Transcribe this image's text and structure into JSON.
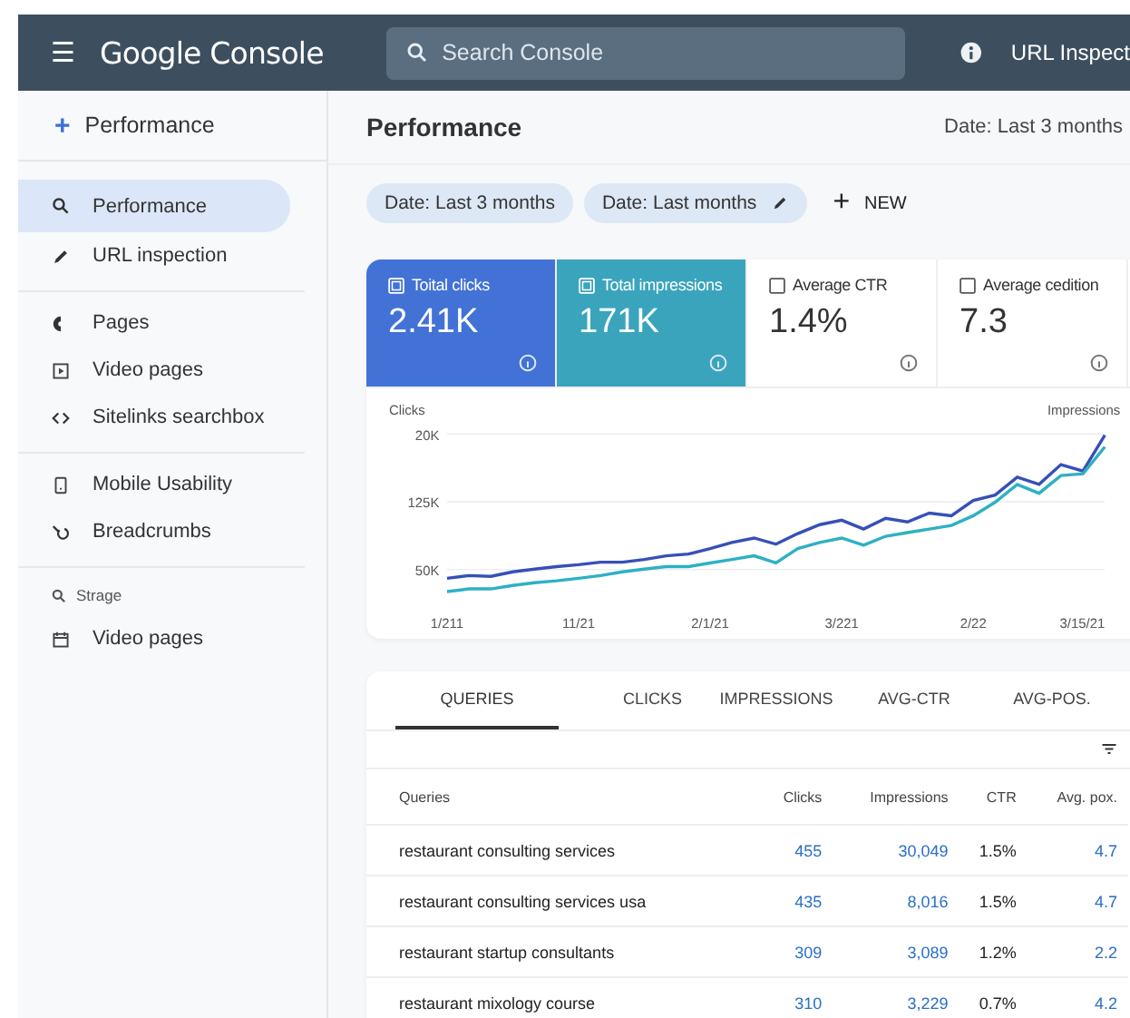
{
  "topbar": {
    "menu_glyph": "☰",
    "title": "Google Console",
    "search": {
      "placeholder": "Search Console"
    },
    "right_link": "URL Inspect"
  },
  "sidebar": {
    "header": {
      "glyph": "+",
      "label": "Performance"
    },
    "sections": [
      {
        "items": [
          {
            "label": "Performance",
            "selected": true
          },
          {
            "label": "URL inspection",
            "selected": false
          }
        ]
      },
      {
        "items": [
          {
            "label": "Pages",
            "selected": false
          },
          {
            "label": "Video pages",
            "selected": false
          },
          {
            "label": "Sitelinks searchbox",
            "selected": false
          }
        ]
      },
      {
        "items": [
          {
            "label": "Mobile Usability",
            "selected": false
          },
          {
            "label": "Breadcrumbs",
            "selected": false
          }
        ]
      },
      {
        "title": "Strage",
        "items": [
          {
            "label": "Video pages",
            "selected": false
          }
        ]
      }
    ]
  },
  "main": {
    "title": "Performance",
    "date_range": "Date: Last 3 months",
    "chips": [
      {
        "label": "Date: Last 3 months",
        "editable": false
      },
      {
        "label": "Date: Last months",
        "editable": true
      }
    ],
    "new_button": {
      "glyph": "+",
      "label": "NEW"
    },
    "metrics": [
      {
        "label": "Toital clicks",
        "value": "2.41K",
        "selected": true,
        "color": "#4272d6"
      },
      {
        "label": "Total impressions",
        "value": "171K",
        "selected": true,
        "color": "#3ba4bd"
      },
      {
        "label": "Average CTR",
        "value": "1.4%",
        "selected": false,
        "color": "#ffffff"
      },
      {
        "label": "Average cedition",
        "value": "7.3",
        "selected": false,
        "color": "#ffffff"
      }
    ],
    "chart": {
      "left_label": "Clicks",
      "right_label": "Impressions",
      "y_labels": [
        "20K",
        "125K",
        "50K"
      ],
      "x_labels": [
        "1/211",
        "11/21",
        "2/1/21",
        "3/221",
        "2/22",
        "3/15/21"
      ]
    }
  },
  "table": {
    "tabs": [
      {
        "label": "QUERIES",
        "selected": true
      },
      {
        "label": "CLICKS",
        "selected": false
      },
      {
        "label": "IMPRESSIONS",
        "selected": false
      },
      {
        "label": "AVG-CTR",
        "selected": false
      },
      {
        "label": "AVG-POS.",
        "selected": false
      }
    ],
    "columns": [
      "Queries",
      "Clicks",
      "Impressions",
      "CTR",
      "Avg. pox."
    ],
    "rows": [
      [
        "restaurant consulting services",
        "455",
        "30,049",
        "1.5%",
        "4.7"
      ],
      [
        "restaurant consulting services usa",
        "435",
        "8,016",
        "1.5%",
        "4.7"
      ],
      [
        "restaurant startup consultants",
        "309",
        "3,089",
        "1.2%",
        "2.2"
      ],
      [
        "restaurant mixology course",
        "310",
        "3,229",
        "0.7%",
        "4.2"
      ]
    ]
  }
}
